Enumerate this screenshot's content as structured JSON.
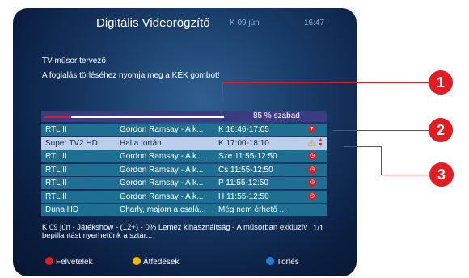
{
  "header": {
    "title": "Digitális Videorögzítő",
    "date": "K 09 jún",
    "time": "16:47"
  },
  "subheader": {
    "line1": "TV-műsor tervező",
    "line2": "A foglalás törléséhez nyomja meg a KÉK gombot!"
  },
  "disk": {
    "free_text": "85 % szabad",
    "used_fraction": 0.15
  },
  "rows": [
    {
      "channel": "RTL II",
      "program": "Gordon Ramsay - A k...",
      "slot": "K 16:46-17:05",
      "icon": "record-square-icon"
    },
    {
      "channel": "Super TV2 HD",
      "program": "Hal a tortán",
      "slot": "K 17:00-18:10",
      "icon": "warning-icon"
    },
    {
      "channel": "RTL II",
      "program": "Gordon Ramsay - A k...",
      "slot": "Sze 11:55-12:50",
      "icon": "clock-icon"
    },
    {
      "channel": "RTL II",
      "program": "Gordon Ramsay - A k...",
      "slot": "Cs 11:55-12:50",
      "icon": "clock-icon"
    },
    {
      "channel": "RTL II",
      "program": "Gordon Ramsay - A k...",
      "slot": "P 11:55-12:50",
      "icon": "clock-icon"
    },
    {
      "channel": "RTL II",
      "program": "Gordon Ramsay - A k...",
      "slot": "H 11:55-12:50",
      "icon": "clock-icon"
    },
    {
      "channel": "Duna HD",
      "program": "Charly, majom a csalá...",
      "slot": "Még nem érhető ...",
      "icon": ""
    }
  ],
  "info": {
    "text": "K 09 jún  - Játékshow - (12+) - 0% Lemez kihasználtság - A műsorban exkluzív bepillantást nyerhetünk a sztár...",
    "page": "1/1"
  },
  "legend": {
    "red": {
      "label": "Felvételek",
      "color": "#e11c22"
    },
    "yellow": {
      "label": "Átfedések",
      "color": "#f2b705"
    },
    "blue": {
      "label": "Törlés",
      "color": "#1e7fd8"
    }
  },
  "callouts": [
    "1",
    "2",
    "3"
  ],
  "colors": {
    "accent": "#e11c22",
    "row": "#1f6f92",
    "selected_row": "#bccfea",
    "disk_panel": "#3c3c82"
  }
}
